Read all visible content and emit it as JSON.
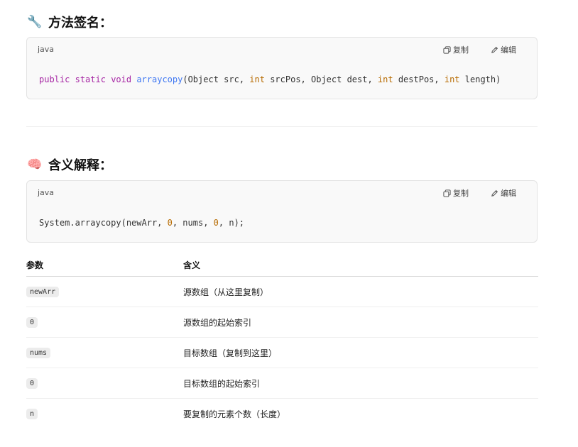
{
  "sections": [
    {
      "emoji": "🔧",
      "icon": "wrench-icon",
      "title": "方法签名：",
      "code": {
        "lang": "java",
        "copy_label": "复制",
        "edit_label": "编辑",
        "tokens": [
          {
            "t": "public",
            "c": "kw"
          },
          {
            "t": " "
          },
          {
            "t": "static",
            "c": "kw"
          },
          {
            "t": " "
          },
          {
            "t": "void",
            "c": "kw"
          },
          {
            "t": " "
          },
          {
            "t": "arraycopy",
            "c": "fn"
          },
          {
            "t": "(Object src, "
          },
          {
            "t": "int",
            "c": "ty"
          },
          {
            "t": " srcPos, Object dest, "
          },
          {
            "t": "int",
            "c": "ty"
          },
          {
            "t": " destPos, "
          },
          {
            "t": "int",
            "c": "ty"
          },
          {
            "t": " length)"
          }
        ]
      }
    },
    {
      "emoji": "🧠",
      "icon": "brain-icon",
      "title": "含义解释：",
      "code": {
        "lang": "java",
        "copy_label": "复制",
        "edit_label": "编辑",
        "tokens": [
          {
            "t": "System.arraycopy(newArr, "
          },
          {
            "t": "0",
            "c": "num"
          },
          {
            "t": ", nums, "
          },
          {
            "t": "0",
            "c": "num"
          },
          {
            "t": ", n);"
          }
        ]
      }
    }
  ],
  "table": {
    "headers": [
      "参数",
      "含义"
    ],
    "rows": [
      {
        "param": "newArr",
        "meaning": "源数组（从这里复制）"
      },
      {
        "param": "0",
        "meaning": "源数组的起始索引"
      },
      {
        "param": "nums",
        "meaning": "目标数组（复制到这里）"
      },
      {
        "param": "0",
        "meaning": "目标数组的起始索引"
      },
      {
        "param": "n",
        "meaning": "要复制的元素个数（长度）"
      }
    ]
  }
}
